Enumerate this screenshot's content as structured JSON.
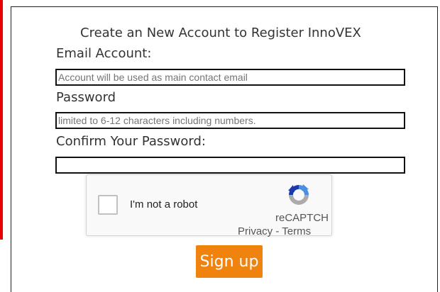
{
  "form": {
    "title": "Create an New Account to Register InnoVEX",
    "email_label": "Email Account:",
    "email_placeholder": "Account will be used as main contact email",
    "password_label": "Password",
    "password_placeholder": "limited to 6-12 characters including numbers.",
    "confirm_label": "Confirm Your Password:",
    "confirm_placeholder": ""
  },
  "recaptcha": {
    "label": "I'm not a robot",
    "brand": "reCAPTCH",
    "privacy_link": "Privacy",
    "separator": " - ",
    "terms_link": "Terms",
    "logo_icon": "recaptcha-logo-icon"
  },
  "signup": {
    "label": "Sign up"
  },
  "colors": {
    "accent_strip": "#e60000",
    "button": "#f0820e",
    "recaptcha_blue": "#4a90e2",
    "recaptcha_dark_blue": "#1c3aa9",
    "recaptcha_gray": "#ababab"
  }
}
